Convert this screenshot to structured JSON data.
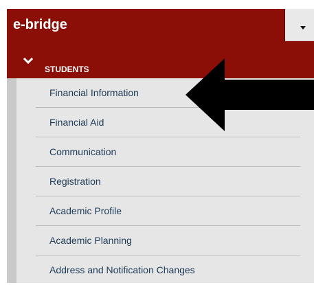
{
  "app": {
    "title": "e-bridge"
  },
  "section": {
    "label": "STUDENTS",
    "expanded": true
  },
  "menu": {
    "items": [
      {
        "label": "Financial Information"
      },
      {
        "label": "Financial Aid"
      },
      {
        "label": "Communication"
      },
      {
        "label": "Registration"
      },
      {
        "label": "Academic Profile"
      },
      {
        "label": "Academic Planning"
      },
      {
        "label": "Address and Notification Changes"
      }
    ]
  },
  "colors": {
    "brand": "#8b0f06",
    "menu_bg": "#e6e6e6",
    "menu_text": "#1d3a57",
    "pointer_arrow": "#000000"
  },
  "icons": {
    "dropdown": "caret-down-icon",
    "section": "chevron-down-icon",
    "pointer": "pointer-arrow"
  }
}
